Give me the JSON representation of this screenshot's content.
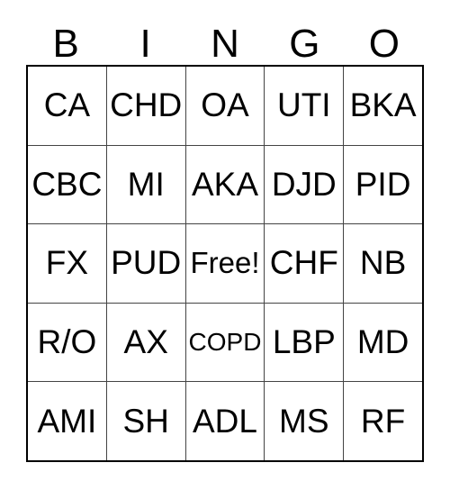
{
  "card": {
    "title_letters": [
      "B",
      "I",
      "N",
      "G",
      "O"
    ],
    "grid": {
      "rows": 5,
      "columns": 5,
      "free_space_label": "Free!",
      "cells": [
        [
          {
            "label": "CA",
            "size": "normal"
          },
          {
            "label": "CHD",
            "size": "normal"
          },
          {
            "label": "OA",
            "size": "normal"
          },
          {
            "label": "UTI",
            "size": "normal"
          },
          {
            "label": "BKA",
            "size": "normal"
          }
        ],
        [
          {
            "label": "CBC",
            "size": "normal"
          },
          {
            "label": "MI",
            "size": "normal"
          },
          {
            "label": "AKA",
            "size": "normal"
          },
          {
            "label": "DJD",
            "size": "normal"
          },
          {
            "label": "PID",
            "size": "normal"
          }
        ],
        [
          {
            "label": "FX",
            "size": "normal"
          },
          {
            "label": "PUD",
            "size": "normal"
          },
          {
            "label": "Free!",
            "size": "medium"
          },
          {
            "label": "CHF",
            "size": "normal"
          },
          {
            "label": "NB",
            "size": "normal"
          }
        ],
        [
          {
            "label": "R/O",
            "size": "normal"
          },
          {
            "label": "AX",
            "size": "normal"
          },
          {
            "label": "COPD",
            "size": "small"
          },
          {
            "label": "LBP",
            "size": "normal"
          },
          {
            "label": "MD",
            "size": "normal"
          }
        ],
        [
          {
            "label": "AMI",
            "size": "normal"
          },
          {
            "label": "SH",
            "size": "normal"
          },
          {
            "label": "ADL",
            "size": "normal"
          },
          {
            "label": "MS",
            "size": "normal"
          },
          {
            "label": "RF",
            "size": "normal"
          }
        ]
      ]
    },
    "colors": {
      "background": "#ffffff",
      "text": "#000000",
      "outer_border": "#000000",
      "inner_grid_line": "#444444"
    }
  }
}
